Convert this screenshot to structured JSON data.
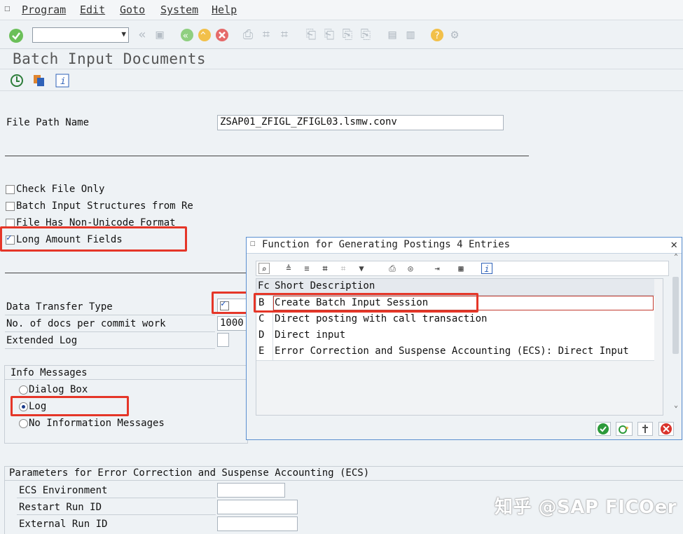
{
  "menu": [
    "Program",
    "Edit",
    "Goto",
    "System",
    "Help"
  ],
  "title": "Batch Input Documents",
  "form": {
    "file_path_label": "File Path Name",
    "file_path_value": "ZSAP01_ZFIGL_ZFIGL03.lsmw.conv",
    "check_file_only": "Check File Only",
    "batch_input_structures": "Batch Input Structures from Re",
    "file_non_unicode": "File Has Non-Unicode Format",
    "long_amount_fields": "Long Amount Fields",
    "data_transfer_type": "Data Transfer Type",
    "docs_per_commit": "No. of docs per commit work",
    "docs_per_commit_value": "1000",
    "extended_log": "Extended Log"
  },
  "info_messages": {
    "title": "Info Messages",
    "options": [
      "Dialog Box",
      "Log",
      "No Information Messages"
    ],
    "selected": "Log"
  },
  "ecs": {
    "title": "Parameters for Error Correction and Suspense Accounting (ECS)",
    "fields": [
      "ECS Environment",
      "Restart Run ID",
      "External Run ID"
    ]
  },
  "dialog": {
    "title": "Function for Generating Postings 4 Entries",
    "columns": [
      "Fc",
      "Short Description"
    ],
    "rows": [
      {
        "code": "B",
        "desc": "Create Batch Input Session"
      },
      {
        "code": "C",
        "desc": "Direct posting with call transaction"
      },
      {
        "code": "D",
        "desc": "Direct input"
      },
      {
        "code": "E",
        "desc": "Error Correction and Suspense Accounting (ECS): Direct Input"
      }
    ]
  },
  "colors": {
    "accent": "#5a8fd0",
    "highlight": "#e53628",
    "ok_green": "#2c9a3a",
    "cancel_red": "#d9332b"
  },
  "watermark": "知乎 @SAP FICOer"
}
